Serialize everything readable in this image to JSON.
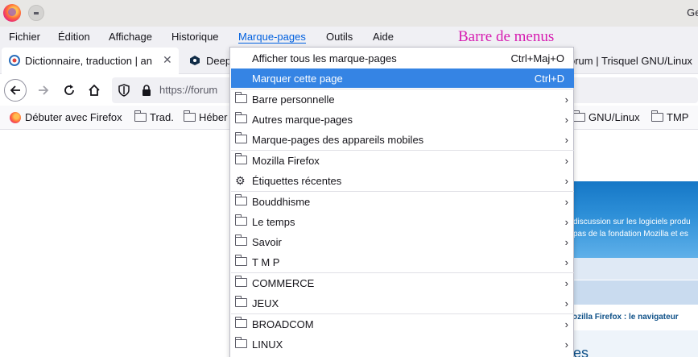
{
  "window": {
    "title_partial": "Gec"
  },
  "menubar": {
    "items": [
      {
        "label": "Fichier",
        "accesskey": "F"
      },
      {
        "label": "Édition",
        "accesskey": "n"
      },
      {
        "label": "Affichage",
        "accesskey": "A"
      },
      {
        "label": "Historique",
        "accesskey": "H"
      },
      {
        "label": "Marque-pages",
        "accesskey": "M"
      },
      {
        "label": "Outils",
        "accesskey": "O"
      },
      {
        "label": "Aide",
        "accesskey": "d"
      }
    ]
  },
  "annotation": {
    "text": "Barre de menus",
    "color": "#d61bb0"
  },
  "tabs": [
    {
      "label": "Dictionnaire, traduction | an",
      "close": "✕",
      "active": true
    },
    {
      "label": "Deep"
    },
    {
      "label": "orum | Trisquel GNU/Linux"
    }
  ],
  "navbar": {
    "url": "https://forum"
  },
  "bookmarks": [
    {
      "label": "Débuter avec Firefox",
      "icon": "firefox-icon"
    },
    {
      "label": "Trad.",
      "icon": "folder-icon"
    },
    {
      "label": "Héber",
      "icon": "folder-icon"
    },
    {
      "label": "GNU/Linux",
      "icon": "folder-icon"
    },
    {
      "label": "TMP",
      "icon": "folder-icon"
    }
  ],
  "page": {
    "header_line1": "discussion sur les logiciels produ",
    "header_line2": "pas de la fondation Mozilla et es",
    "link": "ozilla Firefox : le navigateur",
    "big": "ges"
  },
  "dropdown": {
    "items": [
      {
        "label": "Afficher tous les marque-pages",
        "shortcut": "Ctrl+Maj+O"
      },
      {
        "label": "Marquer cette page",
        "shortcut": "Ctrl+D",
        "highlighted": true
      },
      {
        "label": "Barre personnelle",
        "icon": "folder-icon",
        "submenu": true
      },
      {
        "label": "Autres marque-pages",
        "icon": "folder-icon",
        "submenu": true
      },
      {
        "label": "Marque-pages des appareils mobiles",
        "icon": "folder-icon",
        "submenu": true
      },
      {
        "label": "Mozilla Firefox",
        "icon": "folder-icon",
        "submenu": true
      },
      {
        "label": "Étiquettes récentes",
        "icon": "gear-icon",
        "submenu": true
      },
      {
        "label": "Bouddhisme",
        "icon": "folder-icon",
        "submenu": true
      },
      {
        "label": "Le temps",
        "icon": "folder-icon",
        "submenu": true
      },
      {
        "label": "Savoir",
        "icon": "folder-icon",
        "submenu": true
      },
      {
        "label": "T M P",
        "icon": "folder-icon",
        "submenu": true
      },
      {
        "label": "COMMERCE",
        "icon": "folder-icon",
        "submenu": true
      },
      {
        "label": "JEUX",
        "icon": "folder-icon",
        "submenu": true
      },
      {
        "label": "BROADCOM",
        "icon": "folder-icon",
        "submenu": true
      },
      {
        "label": "LINUX",
        "icon": "folder-icon",
        "submenu": true
      }
    ],
    "arrow": "›",
    "highlight_color": "#3584e4"
  }
}
